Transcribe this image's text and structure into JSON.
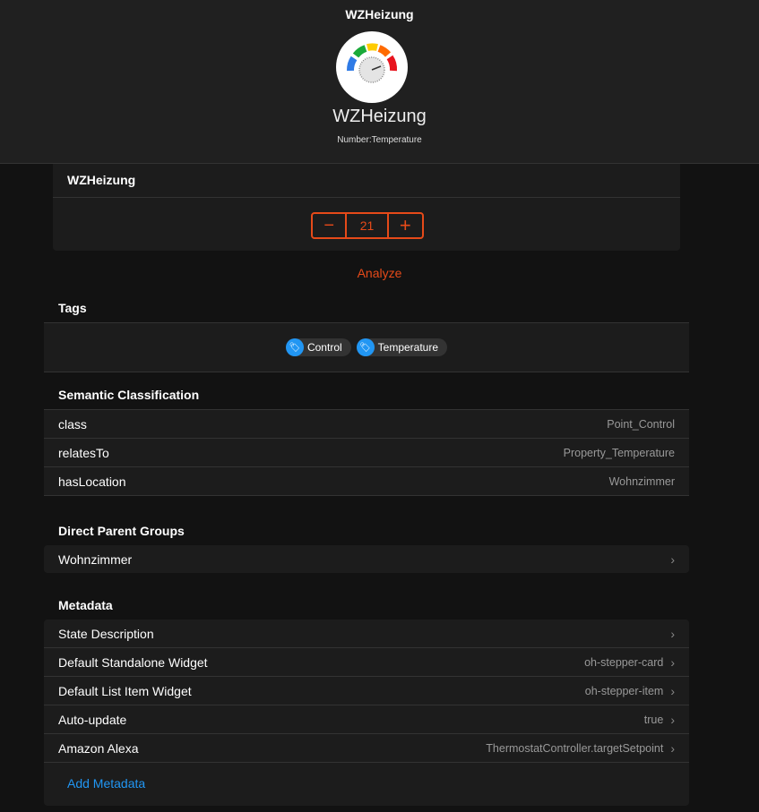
{
  "header": {
    "nav_title": "WZHeizung",
    "name": "WZHeizung",
    "type": "Number:Temperature"
  },
  "control": {
    "title": "WZHeizung",
    "value": "21",
    "minus": "−",
    "plus": "+"
  },
  "analyze": "Analyze",
  "tags": {
    "title": "Tags",
    "items": [
      "Control",
      "Temperature"
    ]
  },
  "semantic": {
    "title": "Semantic Classification",
    "rows": [
      {
        "k": "class",
        "v": "Point_Control"
      },
      {
        "k": "relatesTo",
        "v": "Property_Temperature"
      },
      {
        "k": "hasLocation",
        "v": "Wohnzimmer"
      }
    ]
  },
  "parents": {
    "title": "Direct Parent Groups",
    "items": [
      "Wohnzimmer"
    ]
  },
  "metadata": {
    "title": "Metadata",
    "rows": [
      {
        "k": "State Description",
        "v": ""
      },
      {
        "k": "Default Standalone Widget",
        "v": "oh-stepper-card"
      },
      {
        "k": "Default List Item Widget",
        "v": "oh-stepper-item"
      },
      {
        "k": "Auto-update",
        "v": "true"
      },
      {
        "k": "Amazon Alexa",
        "v": "ThermostatController.targetSetpoint"
      }
    ],
    "add": "Add Metadata"
  },
  "colors": {
    "accent": "#e64a19",
    "link": "#2196f3"
  }
}
